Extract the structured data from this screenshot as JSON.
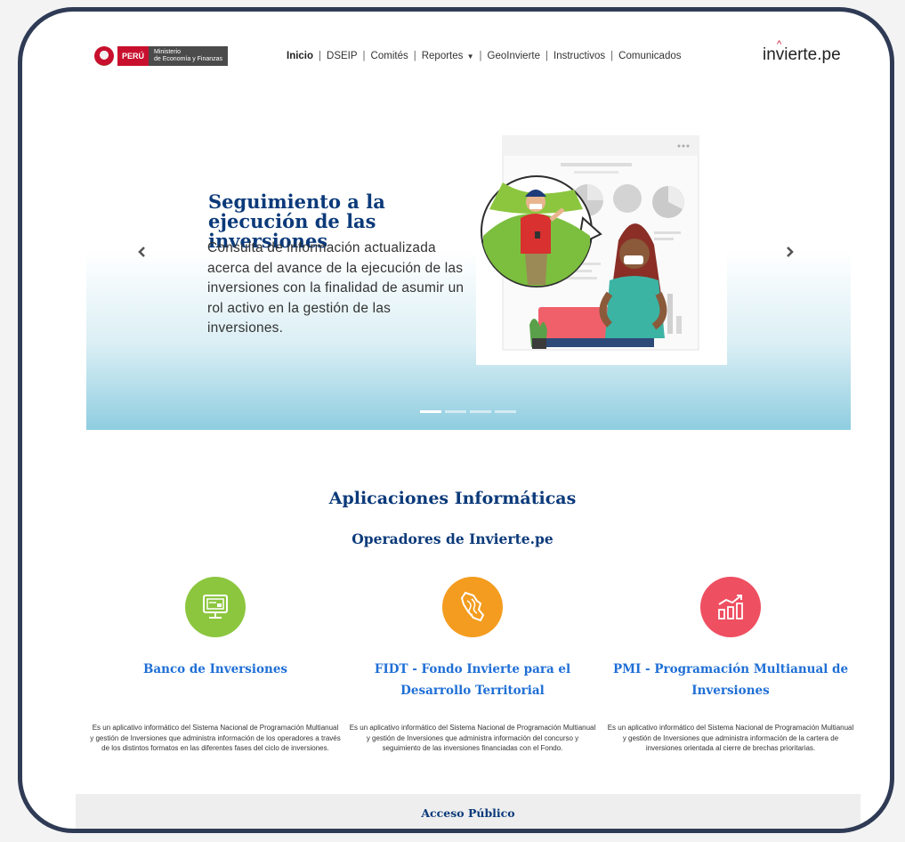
{
  "header": {
    "logo_peru": "PERÚ",
    "logo_ministry_line1": "Ministerio",
    "logo_ministry_line2": "de Economía y Finanzas",
    "nav": {
      "inicio": "Inicio",
      "dseip": "DSEIP",
      "comites": "Comités",
      "reportes": "Reportes",
      "geoinvierte": "GeoInvierte",
      "instructivos": "Instructivos",
      "comunicados": "Comunicados"
    },
    "brand": "invierte.pe"
  },
  "hero": {
    "title": "Seguimiento a la ejecución de las inversiones",
    "text": "Consulta de información actualizada acerca del avance de la ejecución de las inversiones con la finalidad de asumir un rol activo en la gestión de las inversiones.",
    "prev_icon": "chevron-left-icon",
    "next_icon": "chevron-right-icon",
    "slide_count": 4,
    "active_slide": 1
  },
  "apps": {
    "title": "Aplicaciones Informáticas",
    "subtitle": "Operadores de Invierte.pe",
    "cards": [
      {
        "name": "Banco de Inversiones",
        "desc": "Es un aplicativo informático del Sistema Nacional de Programación Multianual y gestión de Inversiones que administra información de los operadores a través de los distintos formatos en las diferentes fases del ciclo de inversiones.",
        "icon": "computer-screen-icon",
        "color": "#8cc63f"
      },
      {
        "name": "FIDT - Fondo Invierte para el Desarrollo Territorial",
        "desc": "Es un aplicativo informático del Sistema Nacional de Programación Multianual y gestión de Inversiones que administra información del concurso y seguimiento de las inversiones financiadas con el Fondo.",
        "icon": "peru-map-icon",
        "color": "#f39c1f"
      },
      {
        "name": "PMI - Programación Multianual de Inversiones",
        "desc": "Es un aplicativo informático del Sistema Nacional de Programación Multianual y gestión de Inversiones que administra información de la cartera de inversiones orientada al cierre de brechas prioritarias.",
        "icon": "growth-chart-icon",
        "color": "#ee4f61"
      }
    ]
  },
  "public_access": "Acceso Público"
}
